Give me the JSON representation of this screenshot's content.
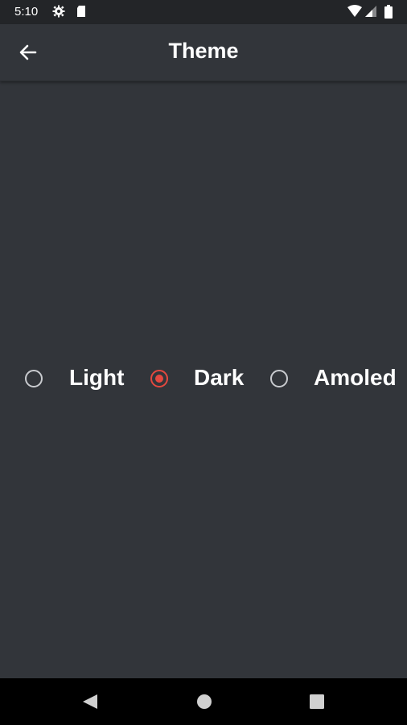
{
  "status_bar": {
    "time": "5:10",
    "icons": [
      "gear-icon",
      "sd-card-icon",
      "wifi-icon",
      "signal-icon",
      "battery-icon"
    ]
  },
  "app_bar": {
    "title": "Theme",
    "back_icon": "arrow-back-icon"
  },
  "theme_options": [
    {
      "label": "Light",
      "selected": false
    },
    {
      "label": "Dark",
      "selected": true
    },
    {
      "label": "Amoled",
      "selected": false
    }
  ],
  "nav_bar": {
    "icons": [
      "nav-back-icon",
      "nav-home-icon",
      "nav-recents-icon"
    ]
  },
  "colors": {
    "background": "#32353a",
    "status_bar": "#232528",
    "accent": "#e5483f",
    "radio_unselected": "#c9cbcf",
    "text": "#ffffff"
  }
}
